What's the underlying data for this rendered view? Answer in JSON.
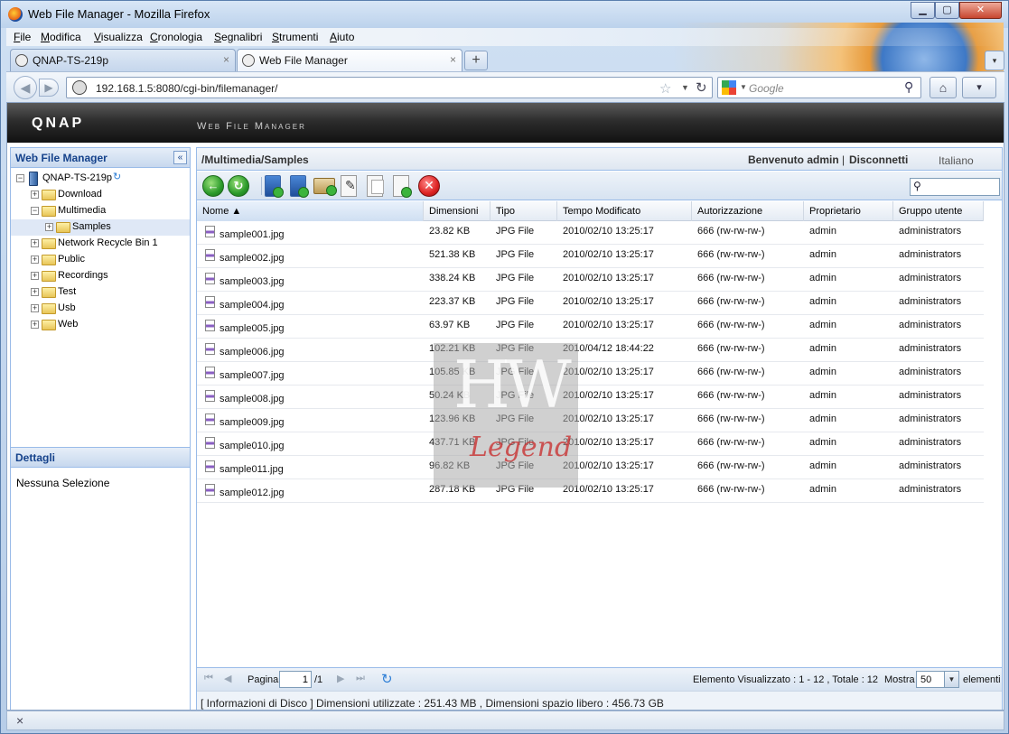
{
  "window": {
    "title": "Web File Manager - Mozilla Firefox",
    "minimize": "▁",
    "maximize": "▢",
    "close": "✕"
  },
  "menu": [
    "File",
    "Modifica",
    "Visualizza",
    "Cronologia",
    "Segnalibri",
    "Strumenti",
    "Aiuto"
  ],
  "tabs": [
    {
      "label": "QNAP-TS-219p",
      "close": "×"
    },
    {
      "label": "Web File Manager",
      "close": "×"
    }
  ],
  "tab_new": "+",
  "tab_list": "▾",
  "nav": {
    "url": "192.168.1.5:8080/cgi-bin/filemanager/",
    "search_placeholder": "Google",
    "back": "◀",
    "forward": "▶",
    "star": "☆",
    "url_dropdown": "▼",
    "reload": "↻",
    "search_dropdown": "▼",
    "search_go": "⚲",
    "home": "⌂",
    "addon": "▾"
  },
  "app": {
    "logo": "QNAP",
    "subtitle": "Web File Manager"
  },
  "left_panel": {
    "title": "Web File Manager",
    "collapse": "«",
    "tree": [
      {
        "label": "QNAP-TS-219p",
        "level": 0,
        "expanded": true,
        "type": "nas"
      },
      {
        "label": "Download",
        "level": 1,
        "expanded": false,
        "type": "folder"
      },
      {
        "label": "Multimedia",
        "level": 1,
        "expanded": true,
        "type": "folder"
      },
      {
        "label": "Samples",
        "level": 2,
        "expanded": false,
        "type": "folder",
        "selected": true
      },
      {
        "label": "Network Recycle Bin 1",
        "level": 1,
        "expanded": false,
        "type": "folder"
      },
      {
        "label": "Public",
        "level": 1,
        "expanded": false,
        "type": "folder"
      },
      {
        "label": "Recordings",
        "level": 1,
        "expanded": false,
        "type": "folder"
      },
      {
        "label": "Test",
        "level": 1,
        "expanded": false,
        "type": "folder"
      },
      {
        "label": "Usb",
        "level": 1,
        "expanded": false,
        "type": "folder"
      },
      {
        "label": "Web",
        "level": 1,
        "expanded": false,
        "type": "folder"
      }
    ]
  },
  "details": {
    "title": "Dettagli",
    "text": "Nessuna Selezione"
  },
  "right_panel": {
    "path": "/Multimedia/Samples",
    "welcome": "Benvenuto admin",
    "separator": "|",
    "logout": "Disconnetti",
    "language": "Italiano"
  },
  "toolbar": {
    "back": "←",
    "refresh": "↻",
    "delete": "✕"
  },
  "filter": {
    "icon": "⚲"
  },
  "grid": {
    "columns": [
      "Nome ▲",
      "Dimensioni",
      "Tipo",
      "Tempo Modificato",
      "Autorizzazione",
      "Proprietario",
      "Gruppo utente"
    ],
    "rows": [
      {
        "name": "sample001.jpg",
        "size": "23.82 KB",
        "type": "JPG File",
        "modified": "2010/02/10 13:25:17",
        "perm": "666 (rw-rw-rw-)",
        "owner": "admin",
        "group": "administrators"
      },
      {
        "name": "sample002.jpg",
        "size": "521.38 KB",
        "type": "JPG File",
        "modified": "2010/02/10 13:25:17",
        "perm": "666 (rw-rw-rw-)",
        "owner": "admin",
        "group": "administrators"
      },
      {
        "name": "sample003.jpg",
        "size": "338.24 KB",
        "type": "JPG File",
        "modified": "2010/02/10 13:25:17",
        "perm": "666 (rw-rw-rw-)",
        "owner": "admin",
        "group": "administrators"
      },
      {
        "name": "sample004.jpg",
        "size": "223.37 KB",
        "type": "JPG File",
        "modified": "2010/02/10 13:25:17",
        "perm": "666 (rw-rw-rw-)",
        "owner": "admin",
        "group": "administrators"
      },
      {
        "name": "sample005.jpg",
        "size": "63.97 KB",
        "type": "JPG File",
        "modified": "2010/02/10 13:25:17",
        "perm": "666 (rw-rw-rw-)",
        "owner": "admin",
        "group": "administrators"
      },
      {
        "name": "sample006.jpg",
        "size": "102.21 KB",
        "type": "JPG File",
        "modified": "2010/04/12 18:44:22",
        "perm": "666 (rw-rw-rw-)",
        "owner": "admin",
        "group": "administrators"
      },
      {
        "name": "sample007.jpg",
        "size": "105.85 KB",
        "type": "JPG File",
        "modified": "2010/02/10 13:25:17",
        "perm": "666 (rw-rw-rw-)",
        "owner": "admin",
        "group": "administrators"
      },
      {
        "name": "sample008.jpg",
        "size": "50.24 KB",
        "type": "JPG File",
        "modified": "2010/02/10 13:25:17",
        "perm": "666 (rw-rw-rw-)",
        "owner": "admin",
        "group": "administrators"
      },
      {
        "name": "sample009.jpg",
        "size": "123.96 KB",
        "type": "JPG File",
        "modified": "2010/02/10 13:25:17",
        "perm": "666 (rw-rw-rw-)",
        "owner": "admin",
        "group": "administrators"
      },
      {
        "name": "sample010.jpg",
        "size": "437.71 KB",
        "type": "JPG File",
        "modified": "2010/02/10 13:25:17",
        "perm": "666 (rw-rw-rw-)",
        "owner": "admin",
        "group": "administrators"
      },
      {
        "name": "sample011.jpg",
        "size": "96.82 KB",
        "type": "JPG File",
        "modified": "2010/02/10 13:25:17",
        "perm": "666 (rw-rw-rw-)",
        "owner": "admin",
        "group": "administrators"
      },
      {
        "name": "sample012.jpg",
        "size": "287.18 KB",
        "type": "JPG File",
        "modified": "2010/02/10 13:25:17",
        "perm": "666 (rw-rw-rw-)",
        "owner": "admin",
        "group": "administrators"
      }
    ]
  },
  "watermark": {
    "top": "HW",
    "bottom": "Legend"
  },
  "paging": {
    "first": "⏮",
    "prev": "◀",
    "next": "▶",
    "last": "⏭",
    "refresh": "↻",
    "label": "Pagina",
    "current": "1",
    "total": "/1",
    "info": "Elemento Visualizzato : 1 - 12 , Totale : 12",
    "show": "Mostra",
    "page_size": "50",
    "size_arrow": "▼",
    "unit": "elementi"
  },
  "disk_info": "[ Informazioni di Disco ] Dimensioni utilizzate : 251.43 MB , Dimensioni spazio libero : 456.73 GB",
  "status": {
    "close": "×"
  }
}
